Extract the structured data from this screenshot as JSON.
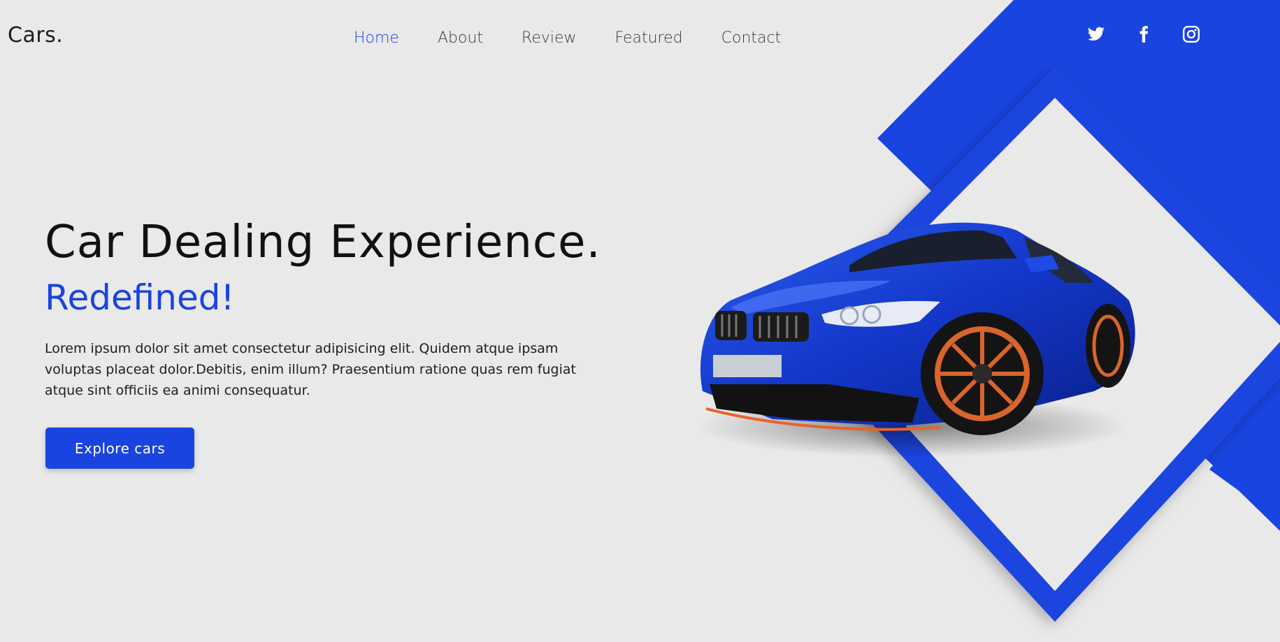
{
  "header": {
    "logo": "Cars.",
    "nav": [
      {
        "label": "Home",
        "active": true
      },
      {
        "label": "About",
        "active": false
      },
      {
        "label": "Review",
        "active": false
      },
      {
        "label": "Featured",
        "active": false
      },
      {
        "label": "Contact",
        "active": false
      }
    ],
    "social": [
      "twitter-icon",
      "facebook-icon",
      "instagram-icon"
    ]
  },
  "hero": {
    "title": "Car Dealing Experience.",
    "subtitle": "Redefined!",
    "text": "Lorem ipsum dolor sit amet consectetur adipisicing elit. Quidem atque ipsam voluptas placeat dolor.Debitis, enim illum? Praesentium ratione quas rem fugiat atque sint officiis ea animi consequatur.",
    "button": "Explore cars"
  },
  "colors": {
    "accent": "#1a44e0",
    "background": "#e9e9ea",
    "text": "#111111"
  }
}
